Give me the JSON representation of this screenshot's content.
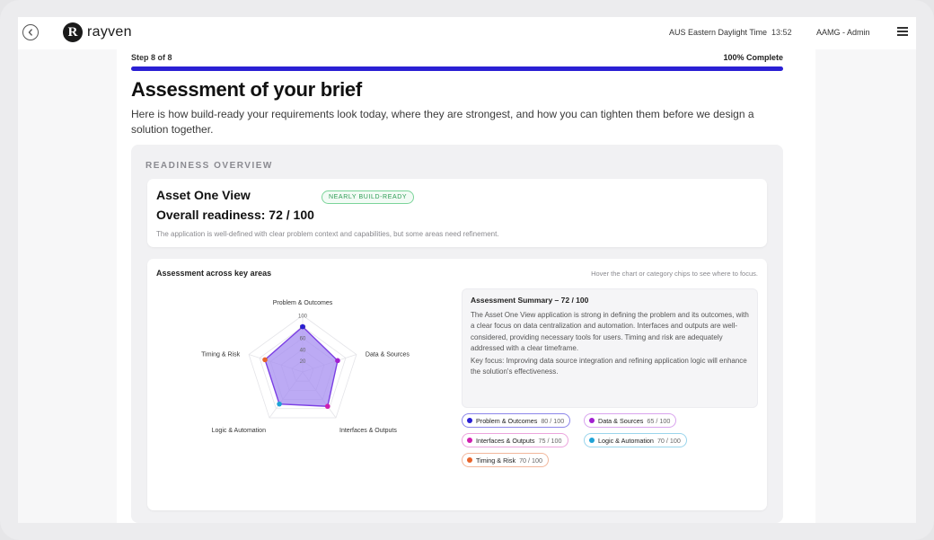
{
  "app": {
    "logo_text": "rayven",
    "timezone": "AUS Eastern Daylight Time",
    "time": "13:52",
    "user": "AAMG - Admin"
  },
  "progress": {
    "step_label": "Step 8 of 8",
    "complete_label": "100% Complete",
    "percent": 100,
    "color": "#2a1fd4"
  },
  "page": {
    "title": "Assessment of your brief",
    "subtitle": "Here is how build-ready your requirements look today, where they are strongest, and how you can tighten them before we design a solution together."
  },
  "overview": {
    "section_label": "READINESS OVERVIEW",
    "app_name": "Asset One View",
    "overall": "Overall readiness: 72 / 100",
    "badge": "NEARLY BUILD-READY",
    "description": "The application is well-defined with clear problem context and capabilities, but some areas need refinement."
  },
  "areas": {
    "title": "Assessment across key areas",
    "hint": "Hover the chart or category chips to see where to focus.",
    "summary_title": "Assessment Summary – 72 / 100",
    "summary_body": "The Asset One View application is strong in defining the problem and its outcomes, with a clear focus on data centralization and automation. Interfaces and outputs are well-considered, providing necessary tools for users. Timing and risk are adequately addressed with a clear timeframe.",
    "summary_focus": "Key focus: Improving data source integration and refining application logic will enhance the solution's effectiveness."
  },
  "chart_data": {
    "type": "radar",
    "axes": [
      "Problem & Outcomes",
      "Data & Sources",
      "Interfaces & Outputs",
      "Logic & Automation",
      "Timing & Risk"
    ],
    "values": [
      80,
      65,
      75,
      70,
      70
    ],
    "max": 100,
    "ticks": [
      "20",
      "40",
      "60",
      "80",
      "100"
    ],
    "point_colors": [
      "#2a1fd4",
      "#a21fd0",
      "#d01fb0",
      "#1fa3d6",
      "#e8632a"
    ],
    "fill_color": "#a58ef0",
    "stroke_color": "#7b3fe4"
  },
  "chips": [
    {
      "label": "Problem & Outcomes",
      "score": "80 / 100",
      "color": "#2a1fd4",
      "border": "#8c86ea"
    },
    {
      "label": "Data & Sources",
      "score": "65 / 100",
      "color": "#a21fd0",
      "border": "#d9a4ee"
    },
    {
      "label": "Interfaces & Outputs",
      "score": "75 / 100",
      "color": "#d01fb0",
      "border": "#eca4dd"
    },
    {
      "label": "Logic & Automation",
      "score": "70 / 100",
      "color": "#1fa3d6",
      "border": "#9ad5ec"
    },
    {
      "label": "Timing & Risk",
      "score": "70 / 100",
      "color": "#e8632a",
      "border": "#f2b79c"
    }
  ]
}
